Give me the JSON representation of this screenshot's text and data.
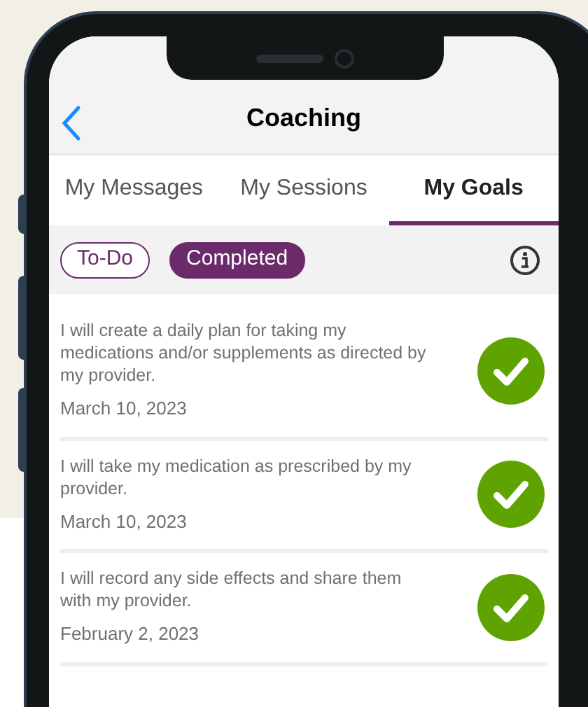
{
  "header": {
    "title": "Coaching"
  },
  "tabs": [
    {
      "label": "My Messages",
      "selected": false
    },
    {
      "label": "My Sessions",
      "selected": false
    },
    {
      "label": "My Goals",
      "selected": true
    }
  ],
  "filters": [
    {
      "label": "To-Do",
      "selected": false
    },
    {
      "label": "Completed",
      "selected": true
    }
  ],
  "goals": [
    {
      "text": "I will create a daily plan for taking my medications and/or supplements as directed by my provider.",
      "date": "March 10, 2023",
      "completed": true
    },
    {
      "text": "I will take my medication as prescribed by my provider.",
      "date": "March 10, 2023",
      "completed": true
    },
    {
      "text": "I will record any side effects and share them with my provider.",
      "date": "February 2, 2023",
      "completed": true
    }
  ]
}
